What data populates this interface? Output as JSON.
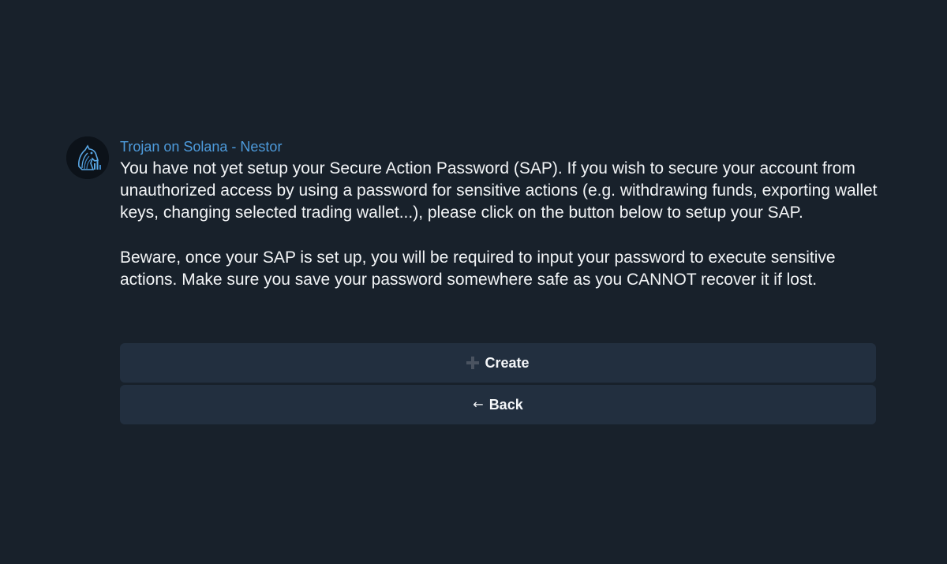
{
  "message": {
    "sender": "Trojan on Solana - Nestor",
    "avatar_icon": "trojan-horse-logo-icon",
    "paragraphs": [
      "You have not yet setup your Secure Action Password (SAP). If you wish to secure your account from unauthorized access by using a password for sensitive actions (e.g. withdrawing funds, exporting wallet keys, changing selected trading wallet...), please click on the button below to setup your SAP.",
      "Beware, once your SAP is set up, you will be required to input your password to execute sensitive actions. Make sure you save your password somewhere safe as you CANNOT recover it if lost."
    ]
  },
  "buttons": {
    "create": {
      "label": "Create",
      "icon": "plus-icon"
    },
    "back": {
      "label": "Back",
      "icon": "arrow-left-icon",
      "glyph": "←"
    }
  },
  "colors": {
    "background": "#18212b",
    "sender": "#4d9bdc",
    "button_bg": "#222f3f",
    "text": "#f2f4f6"
  }
}
